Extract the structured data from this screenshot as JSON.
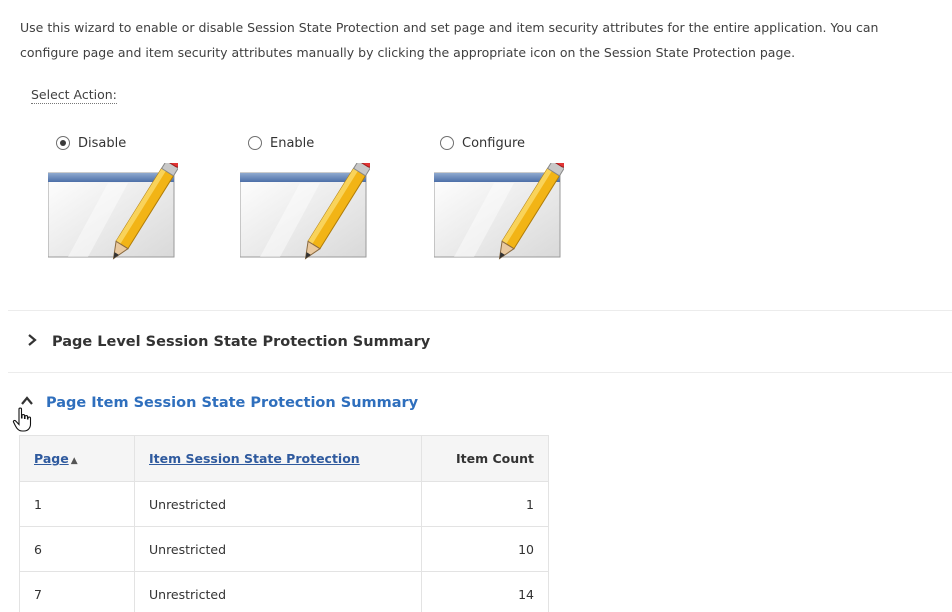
{
  "intro": {
    "line1": "Use this wizard to enable or disable Session State Protection and set page and item security attributes for the entire application. You can",
    "line2": "configure page and item security attributes manually by clicking the appropriate icon on the Session State Protection page."
  },
  "select_action_label": "Select Action:",
  "actions": [
    {
      "label": "Disable",
      "selected": true
    },
    {
      "label": "Enable",
      "selected": false
    },
    {
      "label": "Configure",
      "selected": false
    }
  ],
  "regions": {
    "page_level": {
      "title": "Page Level Session State Protection Summary",
      "state": "collapsed"
    },
    "page_item": {
      "title": "Page Item Session State Protection Summary",
      "state": "expanded"
    }
  },
  "table": {
    "headers": {
      "page": "Page",
      "protection": "Item Session State Protection",
      "count": "Item Count"
    },
    "sort_indicator": "▲",
    "rows": [
      {
        "page": "1",
        "protection": "Unrestricted",
        "count": "1"
      },
      {
        "page": "6",
        "protection": "Unrestricted",
        "count": "10"
      },
      {
        "page": "7",
        "protection": "Unrestricted",
        "count": "14"
      }
    ]
  },
  "colors": {
    "link": "#2f5a9e",
    "region_expanded": "#2f6fbd",
    "pencil": "#f2b416"
  },
  "icons": [
    "edit-window-pencil-icon",
    "chevron-right-icon",
    "chevron-up-icon",
    "hand-pointer-icon"
  ]
}
